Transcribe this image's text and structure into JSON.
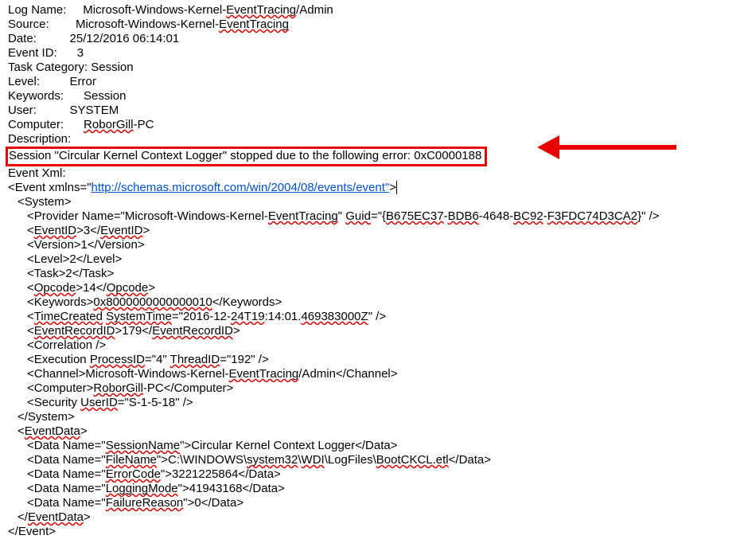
{
  "header": {
    "logName_label": "Log Name:",
    "logName_value_pre": "Microsoft-Windows-Kernel-",
    "logName_value_mid": "EventTracing",
    "logName_value_post": "/Admin",
    "source_label": "Source:",
    "source_value_pre": "Microsoft-Windows-Kernel-",
    "source_value_mid": "EventTracing",
    "date_label": "Date:",
    "date_value": "25/12/2016 06:14:01",
    "eventId_label": "Event ID:",
    "eventId_value": "3",
    "taskCat_label": "Task Category:",
    "taskCat_value": "Session",
    "level_label": "Level:",
    "level_value": "Error",
    "keywords_label": "Keywords:",
    "keywords_value": "Session",
    "user_label": "User:",
    "user_value": "SYSTEM",
    "computer_label": "Computer:",
    "computer_value_pre": "RoborGill",
    "computer_value_post": "-PC",
    "description_label": "Description:",
    "highlighted": "Session \"Circular Kernel Context Logger\" stopped due to the following error: 0xC0000188",
    "eventXml_label": "Event Xml:"
  },
  "xml": {
    "event_open_pre": "<Event xmlns=\"",
    "schema_url": "http://schemas.microsoft.com/win/2004/08/events/event\"",
    "event_open_post": ">",
    "system_open": "<System>",
    "provider_pre": "<Provider Name=\"Microsoft-Windows-Kernel-",
    "provider_mid": "EventTracing",
    "provider_post1": "\" ",
    "guid_word": "Guid",
    "provider_guid_pre": "=\"{",
    "guid_p1": "B675EC37",
    "guid_dash": "-",
    "guid_p2": "BDB6",
    "guid_p3": "-4648-",
    "guid_p4": "BC92",
    "guid_p5": "F3FDC74D3CA2",
    "provider_guid_post": "}\" />",
    "eventid_open": "<",
    "eventid_tag": "EventID",
    "eventid_val": ">3</",
    "eventid_close": ">",
    "version": "<Version>1</Version>",
    "level": "<Level>2</Level>",
    "task": "<Task>2</Task>",
    "opcode_open": "<",
    "opcode_tag": "Opcode",
    "opcode_val": ">14</",
    "opcode_close": ">",
    "keywords_open": "<Keywords>",
    "keywords_val": "0x8000000000000010",
    "keywords_close": "</Keywords>",
    "time_open": "<",
    "time_tag": "TimeCreated",
    "time_sp": " ",
    "systime_tag": "SystemTime",
    "time_eq": "=\"2016-12-",
    "time_dt": "24T19",
    "time_mid": ":14:01.",
    "time_frac": "469383000Z",
    "time_close": "\" />",
    "erid_open": "<",
    "erid_tag": "EventRecordID",
    "erid_val": ">179</",
    "erid_close": ">",
    "correlation": "<Correlation />",
    "exec_open": "<Execution ",
    "procid_tag": "ProcessID",
    "procid_val": "=\"4\" ",
    "threadid_tag": "ThreadID",
    "threadid_val": "=\"192\" />",
    "channel_open": "<Channel>Microsoft-Windows-Kernel-",
    "channel_mid": "EventTracing",
    "channel_close": "/Admin</Channel>",
    "computer_open": "<Computer>",
    "computer_mid": "RoborGill",
    "computer_close": "-PC</Computer>",
    "security_open": "<Security ",
    "userid_tag": "UserID",
    "security_val": "=\"S-1-5-18\" />",
    "system_close": "</System>",
    "evdata_open": "<",
    "evdata_tag": "EventData",
    "evdata_gt": ">",
    "d1_open": "<Data Name=\"",
    "d1_name": "SessionName",
    "d1_mid": "\">Circular Kernel Context Logger</Data>",
    "d2_open": "<Data Name=\"",
    "d2_name": "FileName",
    "d2_mid": "\">C:\\WINDOWS\\",
    "d2_sys": "system32",
    "d2_bs": "\\",
    "d2_wdi": "WDI",
    "d2_lf": "\\LogFiles\\",
    "d2_boot": "BootCKCL.etl",
    "d2_close": "</Data>",
    "d3_open": "<Data Name=\"",
    "d3_name": "ErrorCode",
    "d3_mid": "\">3221225864</Data>",
    "d4_open": "<Data Name=\"",
    "d4_name": "LoggingMode",
    "d4_mid": "\">41943168</Data>",
    "d5_open": "<Data Name=\"",
    "d5_name": "FailureReason",
    "d5_mid": "\">0</Data>",
    "evdata_close_open": "</",
    "evdata_close_gt": ">",
    "event_close": "</Event>"
  }
}
